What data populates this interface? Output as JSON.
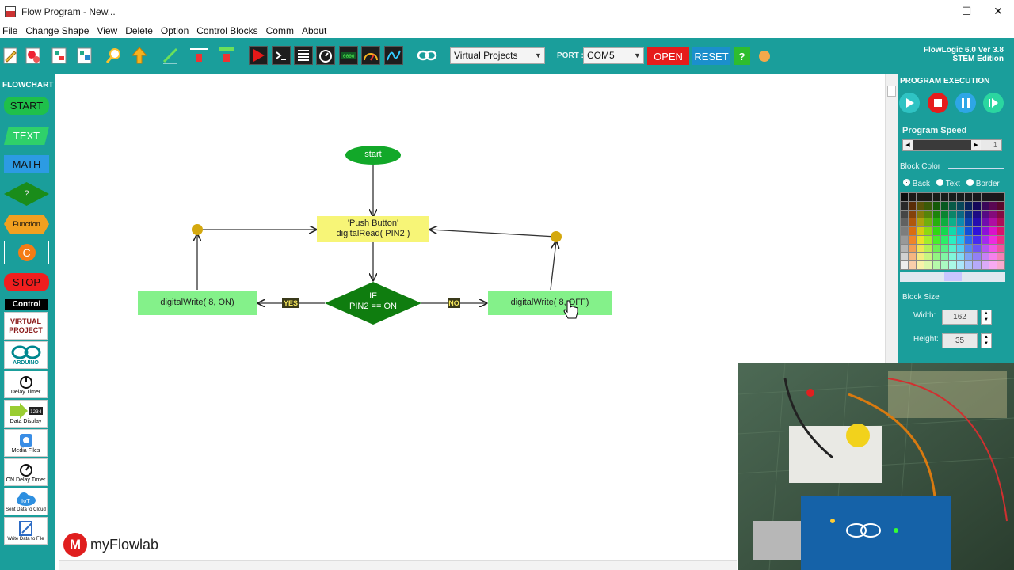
{
  "window": {
    "title": "Flow Program - New...",
    "controls": [
      "—",
      "☐",
      "✕"
    ]
  },
  "menu": [
    "File",
    "Change Shape",
    "View",
    "Delete",
    "Option",
    "Control Blocks",
    "Comm",
    "About"
  ],
  "toolbar": {
    "projects_select": "Virtual Projects",
    "port_label": "PORT :",
    "port_select": "COM5",
    "open_label": "OPEN",
    "reset_label": "RESET",
    "help_label": "?",
    "brand_line1": "FlowLogic 6.0 Ver 3.8",
    "brand_line2": "STEM Edition",
    "colors": {
      "bg": "#1a9e9b",
      "open": "#e61c1c",
      "reset": "#1b8fcc",
      "help": "#2ebd2e"
    }
  },
  "flowchart_panel": {
    "heading": "FLOWCHART",
    "shapes": [
      {
        "label": "START",
        "color": "#1fc04a"
      },
      {
        "label": "TEXT",
        "color": "#2fd06a"
      },
      {
        "label": "MATH",
        "color": "#2c9be3"
      },
      {
        "label": "?",
        "color": "#1a8c1a"
      },
      {
        "label": "Function",
        "color": "#f0a020"
      },
      {
        "label": "C",
        "color": "#f57c14"
      },
      {
        "label": "STOP",
        "color": "#f01e1e"
      }
    ],
    "control_heading": "Control",
    "controls": [
      {
        "label": "VIRTUAL PROJECT"
      },
      {
        "label": "ARDUINO"
      },
      {
        "label": "Delay Timer"
      },
      {
        "label": "Data Display"
      },
      {
        "label": "Media Files"
      },
      {
        "label": "ON Delay Timer"
      },
      {
        "label": "Sent Data to Cloud"
      },
      {
        "label": "Write Data to File"
      }
    ]
  },
  "flowchart": {
    "start": "start",
    "read_line1": "'Push Button'",
    "read_line2": "digitalRead( PIN2 )",
    "if_line1": "IF",
    "if_line2": "PIN2 == ON",
    "yes": "YES",
    "no": "NO",
    "write_on": "digitalWrite( 8, ON)",
    "write_off": "digitalWrite( 8, OFF)"
  },
  "execution_panel": {
    "heading": "PROGRAM EXECUTION",
    "speed_label": "Program Speed",
    "speed_value": "1",
    "block_color_label": "Block Color",
    "color_targets": [
      "Back",
      "Text",
      "Border"
    ],
    "selected_target": "Back",
    "block_size_label": "Block Size",
    "width_label": "Width:",
    "width_value": "162",
    "height_label": "Height:",
    "height_value": "35"
  },
  "watermark": {
    "logo_letter": "M",
    "text": "myFlowlab"
  }
}
